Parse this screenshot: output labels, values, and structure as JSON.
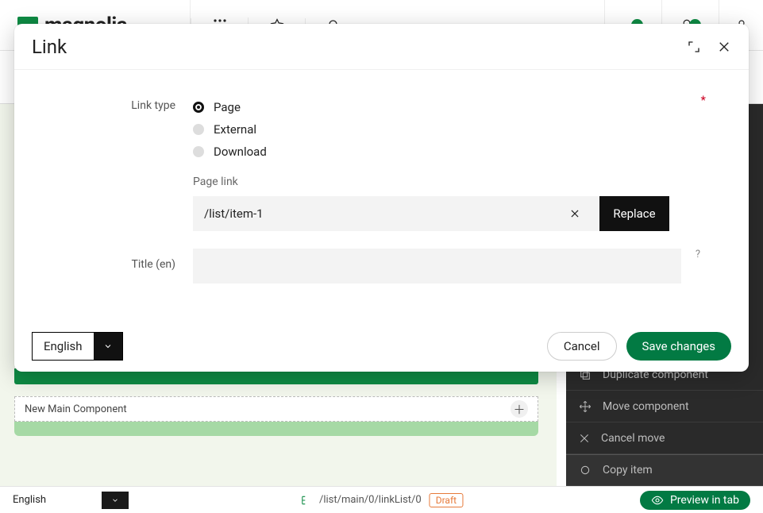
{
  "app": {
    "brand": "magnolia"
  },
  "dialog": {
    "title": "Link",
    "link_type_label": "Link type",
    "radios": {
      "page": "Page",
      "external": "External",
      "download": "Download"
    },
    "page_link_label": "Page link",
    "page_link_value": "/list/item-1",
    "replace_label": "Replace",
    "title_en_label": "Title (en)",
    "title_en_value": "",
    "required_marker": "*",
    "help_marker": "?",
    "language": "English",
    "cancel_label": "Cancel",
    "save_label": "Save changes"
  },
  "canvas": {
    "new_main_label": "New Main Component"
  },
  "panel": {
    "duplicate_label": "Duplicate component",
    "move_label": "Move component",
    "cancel_move_label": "Cancel move",
    "copy_label": "Copy item"
  },
  "bottom": {
    "language": "English",
    "path": "/list/main/0/linkList/0",
    "status": "Draft",
    "preview_label": "Preview in tab"
  }
}
